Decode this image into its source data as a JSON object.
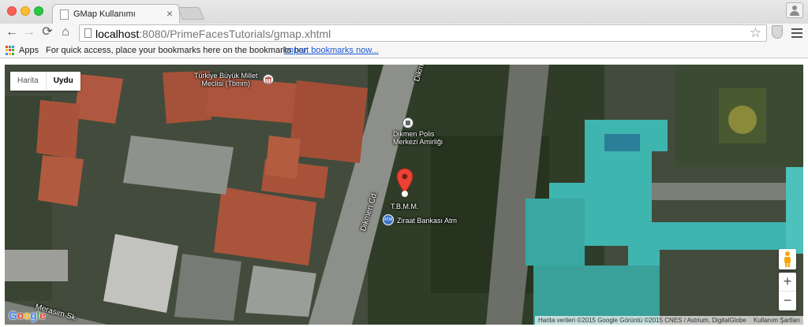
{
  "browser": {
    "tab_title": "GMap Kullanımı",
    "tab_close": "×",
    "url_host": "localhost",
    "url_path": ":8080/PrimeFacesTutorials/gmap.xhtml",
    "back_glyph": "←",
    "forward_glyph": "→",
    "reload_glyph": "⟳",
    "home_glyph": "⌂",
    "star_glyph": "☆"
  },
  "bookmarks": {
    "apps_label": "Apps",
    "hint": "For quick access, place your bookmarks here on the bookmarks bar.",
    "import_link": "Import bookmarks now..."
  },
  "map": {
    "type_control": {
      "options": [
        "Harita",
        "Uydu"
      ],
      "selected": "Uydu"
    },
    "labels": {
      "parliament_line1": "Türkiye Büyük Millet",
      "parliament_line2": "Meclisi (Tbmm)",
      "police_line1": "Dikmen Polis",
      "police_line2": "Merkezi Amirliği",
      "marker_label": "T.B.M.M.",
      "bank": "Ziraat Bankası Atm",
      "atm_badge": "ATM",
      "street_dikmen_cd": "Dikmen Cd.",
      "street_dikmen_top": "Dikmen",
      "street_merasim": "Merasim Sk."
    },
    "zoom_in": "+",
    "zoom_out": "−",
    "logo": [
      "G",
      "o",
      "o",
      "g",
      "l",
      "e"
    ],
    "logo_colors": [
      "#4285f4",
      "#ea4335",
      "#fbbc05",
      "#4285f4",
      "#34a853",
      "#ea4335"
    ],
    "attribution": "Harita verileri ©2015 Google Görüntü ©2015 CNES / Astrium, DigitalGlobe",
    "terms": "Kullanım Şartları",
    "marker_color": "#ea4335"
  }
}
